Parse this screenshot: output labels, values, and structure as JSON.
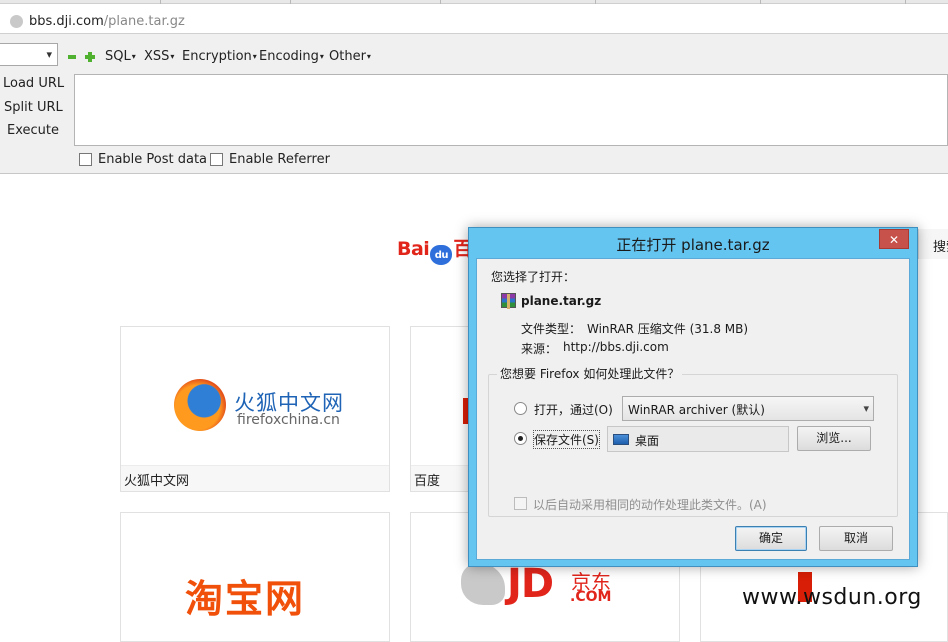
{
  "browser": {
    "url_host": "bbs.dji.com",
    "url_path": "/plane.tar.gz"
  },
  "hackbar": {
    "menus": [
      "SQL",
      "XSS",
      "Encryption",
      "Encoding",
      "Other"
    ],
    "load_url": "Load URL",
    "split_url": "Split URL",
    "execute": "Execute",
    "enable_post": "Enable Post data",
    "enable_referrer": "Enable Referrer"
  },
  "page": {
    "search_button": "搜索",
    "tiles": [
      {
        "label": "火狐中文网",
        "logo_title": "火狐中文网",
        "logo_sub": "firefoxchina.cn"
      },
      {
        "label": "百度"
      },
      {
        "logo_text": "淘宝网"
      },
      {
        "logo_text": "JD",
        "logo_sub": "京东",
        "logo_com": ".COM"
      }
    ],
    "watermark": "www.wsdun.org"
  },
  "dialog": {
    "title": "正在打开 plane.tar.gz",
    "close": "✕",
    "chosen_label": "您选择了打开：",
    "file_name": "plane.tar.gz",
    "file_type_label": "文件类型：",
    "file_type_value": "WinRAR 压缩文件 (31.8 MB)",
    "source_label": "来源：",
    "source_value": "http://bbs.dji.com",
    "question": "您想要 Firefox 如何处理此文件？",
    "open_with_label": "打开，通过(O)",
    "open_with_app": "WinRAR archiver (默认)",
    "save_label": "保存文件(S)",
    "save_folder": "桌面",
    "browse": "浏览...",
    "remember": "以后自动采用相同的动作处理此类文件。(A)",
    "ok": "确定",
    "cancel": "取消",
    "selected_option": "save"
  }
}
